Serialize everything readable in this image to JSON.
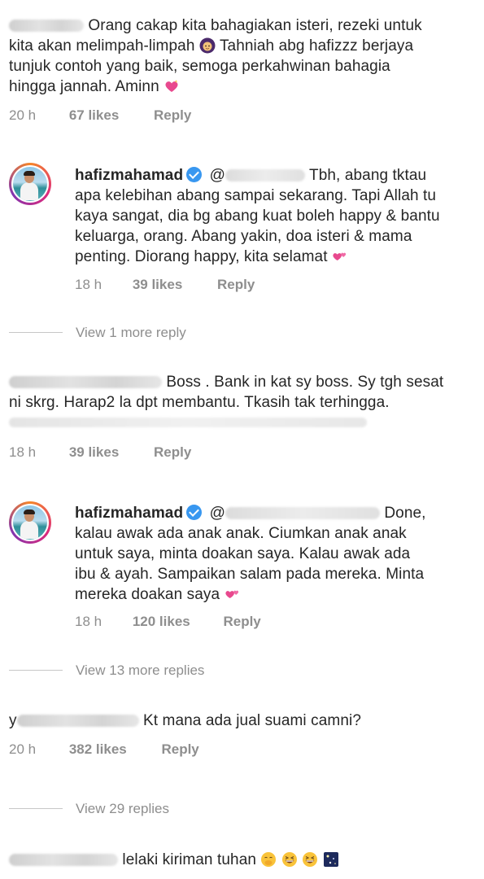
{
  "comments": [
    {
      "text_lines": [
        "Orang cakap kita bahagiakan isteri, rezeki untuk",
        "kita akan melimpah-limpah",
        "Tahniah abg hafizzz berjaya",
        "tunjuk contoh yang baik, semoga perkahwinan bahagia",
        "hingga jannah. Aminn"
      ],
      "time": "20 h",
      "likes": "67 likes",
      "reply": "Reply"
    },
    {
      "username": "hafizmahamad",
      "text_lines": [
        "Tbh, abang tktau",
        "apa kelebihan abang sampai sekarang. Tapi Allah tu",
        "kaya sangat, dia bg abang kuat boleh happy & bantu",
        "keluarga, orang. Abang yakin, doa isteri & mama",
        "penting. Diorang happy, kita selamat"
      ],
      "time": "18 h",
      "likes": "39 likes",
      "reply": "Reply"
    },
    {
      "view_more": "View 1 more reply"
    },
    {
      "text_lines": [
        "Boss . Bank in kat sy boss. Sy tgh sesat",
        "ni skrg. Harap2 la dpt membantu. Tkasih tak terhingga."
      ],
      "time": "18 h",
      "likes": "39 likes",
      "reply": "Reply"
    },
    {
      "username": "hafizmahamad",
      "text_lines": [
        "Done,",
        "kalau awak ada anak anak. Ciumkan anak anak",
        "untuk saya, minta doakan saya. Kalau awak ada",
        "ibu & ayah. Sampaikan salam pada mereka. Minta",
        "mereka doakan saya"
      ],
      "time": "18 h",
      "likes": "120 likes",
      "reply": "Reply"
    },
    {
      "view_more": "View 13 more replies"
    },
    {
      "text_lines": [
        "Kt mana ada jual suami camni?"
      ],
      "username_initial": "y",
      "time": "20 h",
      "likes": "382 likes",
      "reply": "Reply"
    },
    {
      "view_more": "View 29 replies"
    },
    {
      "text_lines": [
        "lelaki kiriman tuhan"
      ]
    }
  ],
  "icons": {
    "heart": "sparkling-heart-emoji",
    "hijab_face": "woman-headscarf-emoji",
    "hearts": "two-hearts-emoji",
    "verified": "verified-badge-icon",
    "blush": "face-with-hand-over-mouth-emoji",
    "laugh": "grinning-squinting-face-emoji",
    "night": "milky-way-emoji"
  },
  "colors": {
    "text": "#262626",
    "meta": "#8e8e8e",
    "verified": "#3897f0",
    "heart": "#e8498e"
  }
}
